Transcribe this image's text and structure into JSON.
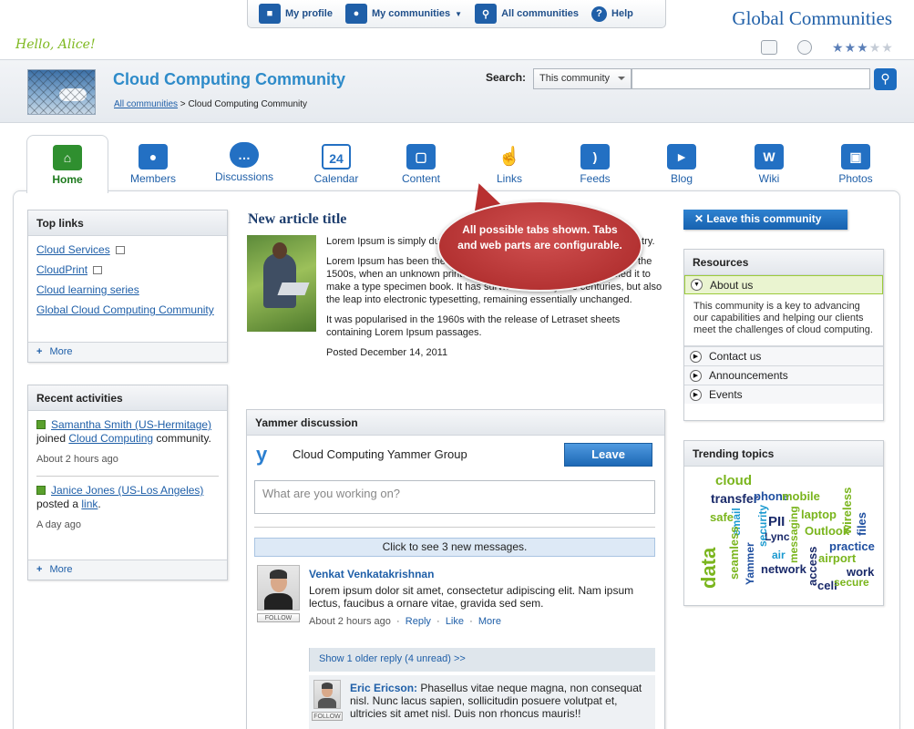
{
  "topnav": {
    "my_profile": "My profile",
    "my_communities": "My communities",
    "all_communities": "All communities",
    "help": "Help"
  },
  "brand": "Global Communities",
  "greeting": "Hello, Alice!",
  "rating": {
    "value": 3,
    "max": 5
  },
  "community": {
    "title": "Cloud Computing Community",
    "breadcrumb_root": "All communities",
    "breadcrumb_sep": " > ",
    "breadcrumb_current": "Cloud Computing Community"
  },
  "search": {
    "label": "Search:",
    "scope": "This community",
    "placeholder": ""
  },
  "tabs": [
    {
      "label": "Home",
      "icon": "home-icon"
    },
    {
      "label": "Members",
      "icon": "members-icon"
    },
    {
      "label": "Discussions",
      "icon": "discussions-icon"
    },
    {
      "label": "Calendar",
      "icon": "calendar-icon"
    },
    {
      "label": "Content",
      "icon": "folder-icon"
    },
    {
      "label": "Links",
      "icon": "pointer-icon"
    },
    {
      "label": "Feeds",
      "icon": "rss-icon"
    },
    {
      "label": "Blog",
      "icon": "megaphone-icon"
    },
    {
      "label": "Wiki",
      "icon": "wiki-icon"
    },
    {
      "label": "Photos",
      "icon": "photos-icon"
    }
  ],
  "calendar_day": "24",
  "top_links": {
    "title": "Top links",
    "items": [
      "Cloud Services",
      "CloudPrint",
      "Cloud learning series",
      "Global Cloud Computing Community"
    ],
    "more": "More"
  },
  "recent": {
    "title": "Recent activities",
    "a1": {
      "user": "Samantha Smith (US-Hermitage)",
      "mid": " joined ",
      "target": "Cloud Computing",
      "tail": " community.",
      "time": "About 2 hours ago"
    },
    "a2": {
      "user": "Janice Jones (US-Los Angeles)",
      "mid": "posted a ",
      "target": "link",
      "tail": ".",
      "time": "A day ago"
    },
    "more": "More"
  },
  "article": {
    "title": "New article title",
    "p1": "Lorem Ipsum is simply dummy text of the printing and typesetting industry.",
    "p2": "Lorem Ipsum has been the industry's standard dummy text ever since the 1500s, when an unknown printer took a galley of type and scrambled it to make a type specimen book. It has survived not only five centuries, but also the leap into electronic typesetting, remaining essentially unchanged.",
    "p3": "It was popularised in the 1960s with the release of Letraset sheets containing Lorem Ipsum passages.",
    "posted": "Posted December 14, 2011"
  },
  "callout": "All possible tabs shown. Tabs and web parts are configurable.",
  "yammer": {
    "title": "Yammer discussion",
    "group": "Cloud Computing Yammer Group",
    "leave": "Leave",
    "placeholder": "What are you working on?",
    "new_messages": "Click to see 3 new messages.",
    "m1": {
      "name": "Venkat Venkatakrishnan",
      "text": "Lorem ipsum dolor sit amet, consectetur adipiscing elit. Nam ipsum lectus, faucibus a ornare vitae, gravida sed sem.",
      "time": "About 2 hours ago",
      "reply": "Reply",
      "like": "Like",
      "more": "More",
      "follow": "FOLLOW"
    },
    "older": "Show 1 older reply (4 unread) >>",
    "m2": {
      "name": "Eric Ericson:",
      "text": " Phasellus vitae neque magna, non consequat nisl. Nunc lacus sapien, sollicitudin posuere volutpat et, ultricies sit amet nisl. Duis non rhoncus mauris!!",
      "follow": "FOLLOW"
    }
  },
  "leave_community": "Leave this community",
  "resources": {
    "title": "Resources",
    "about": "About us",
    "about_text": "This community is a key to advancing our capabilities and helping our clients meet the challenges of cloud computing.",
    "items": [
      "Contact us",
      "Announcements",
      "Events"
    ]
  },
  "trending": {
    "title": "Trending topics",
    "words": [
      "cloud",
      "transfer",
      "phone",
      "mobile",
      "safe",
      "email",
      "PII",
      "Lync",
      "laptop",
      "wireless",
      "files",
      "data",
      "seamless",
      "Yammer",
      "security",
      "air",
      "messaging",
      "Outlook",
      "practice",
      "network",
      "access",
      "airport",
      "work",
      "cell",
      "secure"
    ]
  },
  "colors": {
    "accent": "#1f5fa8",
    "home_green": "#2f8f2f",
    "callout_red": "#b83030",
    "hello_green": "#7db81e"
  }
}
